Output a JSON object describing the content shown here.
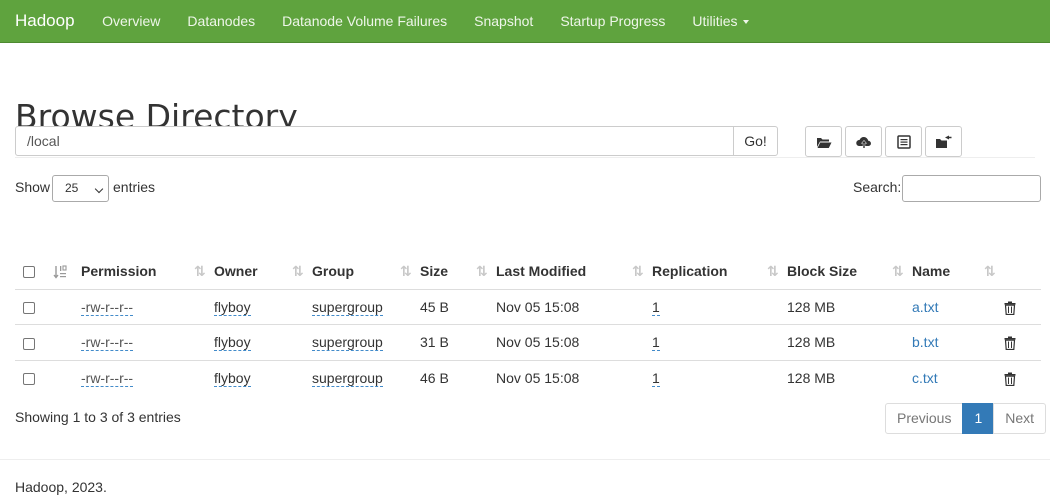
{
  "nav": {
    "brand": "Hadoop",
    "items": [
      "Overview",
      "Datanodes",
      "Datanode Volume Failures",
      "Snapshot",
      "Startup Progress",
      "Utilities"
    ]
  },
  "page_title": "Browse Directory",
  "path": {
    "value": "/local",
    "go_label": "Go!"
  },
  "toolbar_icons": [
    "folder-open-icon",
    "cloud-upload-icon",
    "list-alt-icon",
    "folder-move-icon"
  ],
  "show": {
    "prefix": "Show",
    "value": "25",
    "suffix": "entries"
  },
  "search": {
    "label": "Search:",
    "value": ""
  },
  "table": {
    "headers": [
      "Permission",
      "Owner",
      "Group",
      "Size",
      "Last Modified",
      "Replication",
      "Block Size",
      "Name"
    ],
    "rows": [
      {
        "permission": "-rw-r--r--",
        "owner": "flyboy",
        "group": "supergroup",
        "size": "45 B",
        "modified": "Nov 05 15:08",
        "replication": "1",
        "block_size": "128 MB",
        "name": "a.txt"
      },
      {
        "permission": "-rw-r--r--",
        "owner": "flyboy",
        "group": "supergroup",
        "size": "31 B",
        "modified": "Nov 05 15:08",
        "replication": "1",
        "block_size": "128 MB",
        "name": "b.txt"
      },
      {
        "permission": "-rw-r--r--",
        "owner": "flyboy",
        "group": "supergroup",
        "size": "46 B",
        "modified": "Nov 05 15:08",
        "replication": "1",
        "block_size": "128 MB",
        "name": "c.txt"
      }
    ]
  },
  "info": "Showing 1 to 3 of 3 entries",
  "pagination": {
    "previous": "Previous",
    "current": "1",
    "next": "Next"
  },
  "footer": "Hadoop, 2023.",
  "colors": {
    "navbar": "#5fa33e",
    "link": "#337ab7",
    "active_page": "#337ab7"
  }
}
